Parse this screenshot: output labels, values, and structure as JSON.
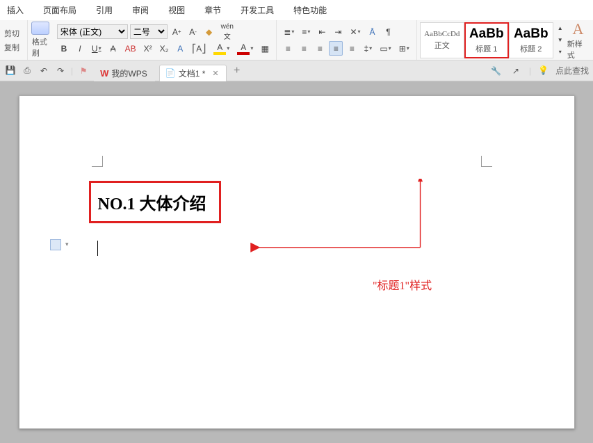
{
  "menu": [
    "插入",
    "页面布局",
    "引用",
    "审阅",
    "视图",
    "章节",
    "开发工具",
    "特色功能"
  ],
  "clipboard": {
    "cut": "剪切",
    "copy": "复制",
    "painter": "格式刷"
  },
  "font": {
    "name": "宋体 (正文)",
    "size": "二号"
  },
  "styles": {
    "normal": {
      "preview": "AaBbCcDd",
      "label": "正文"
    },
    "h1": {
      "preview": "AaBb",
      "label": "标题 1"
    },
    "h2": {
      "preview": "AaBb",
      "label": "标题 2"
    },
    "new": "新样式"
  },
  "tabs": {
    "wps": "我的WPS",
    "doc": "文档1 *",
    "add": "+"
  },
  "statusRight": "点此查找",
  "document": {
    "heading": "NO.1 大体介绍"
  },
  "annotation": "\"标题1\"样式"
}
